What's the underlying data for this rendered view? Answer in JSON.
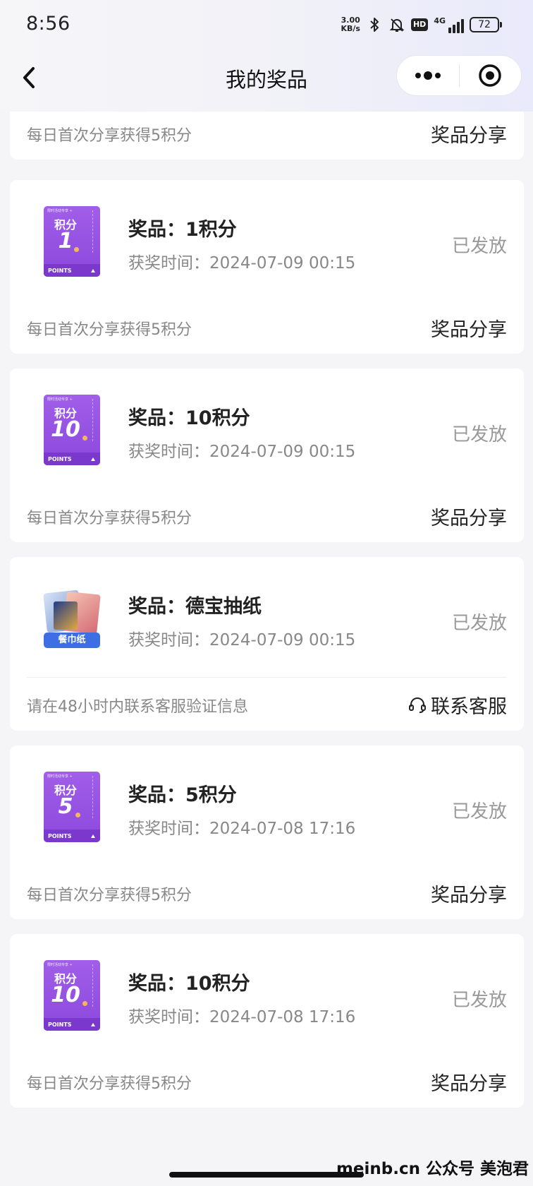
{
  "status_bar": {
    "time": "8:56",
    "net_speed_value": "3.00",
    "net_speed_unit": "KB/s",
    "hd": "HD",
    "network": "4G",
    "battery": "72"
  },
  "nav": {
    "title": "我的奖品"
  },
  "partial_card": {
    "footer_text": "每日首次分享获得5积分",
    "footer_action": "奖品分享"
  },
  "prizes": [
    {
      "thumb_type": "points",
      "ticket_word": "积分",
      "ticket_number": "1",
      "ticket_points": "POINTS",
      "name": "奖品：1积分",
      "time": "获奖时间：2024-07-09 00:15",
      "status": "已发放",
      "footer_text": "每日首次分享获得5积分",
      "footer_action": "奖品分享"
    },
    {
      "thumb_type": "points",
      "ticket_word": "积分",
      "ticket_number": "10",
      "ticket_points": "POINTS",
      "name": "奖品：10积分",
      "time": "获奖时间：2024-07-09 00:15",
      "status": "已发放",
      "footer_text": "每日首次分享获得5积分",
      "footer_action": "奖品分享"
    },
    {
      "thumb_type": "tissue",
      "thumb_label": "餐巾纸",
      "name": "奖品：德宝抽纸",
      "time": "获奖时间：2024-07-09 00:15",
      "status": "已发放",
      "footer_text": "请在48小时内联系客服验证信息",
      "footer_action": "联系客服"
    },
    {
      "thumb_type": "points",
      "ticket_word": "积分",
      "ticket_number": "5",
      "ticket_points": "POINTS",
      "name": "奖品：5积分",
      "time": "获奖时间：2024-07-08 17:16",
      "status": "已发放",
      "footer_text": "每日首次分享获得5积分",
      "footer_action": "奖品分享"
    },
    {
      "thumb_type": "points",
      "ticket_word": "积分",
      "ticket_number": "10",
      "ticket_points": "POINTS",
      "name": "奖品：10积分",
      "time": "获奖时间：2024-07-08 17:16",
      "status": "已发放",
      "footer_text": "每日首次分享获得5积分",
      "footer_action": "奖品分享"
    }
  ],
  "watermark": "meinb.cn  公众号 美泡君"
}
